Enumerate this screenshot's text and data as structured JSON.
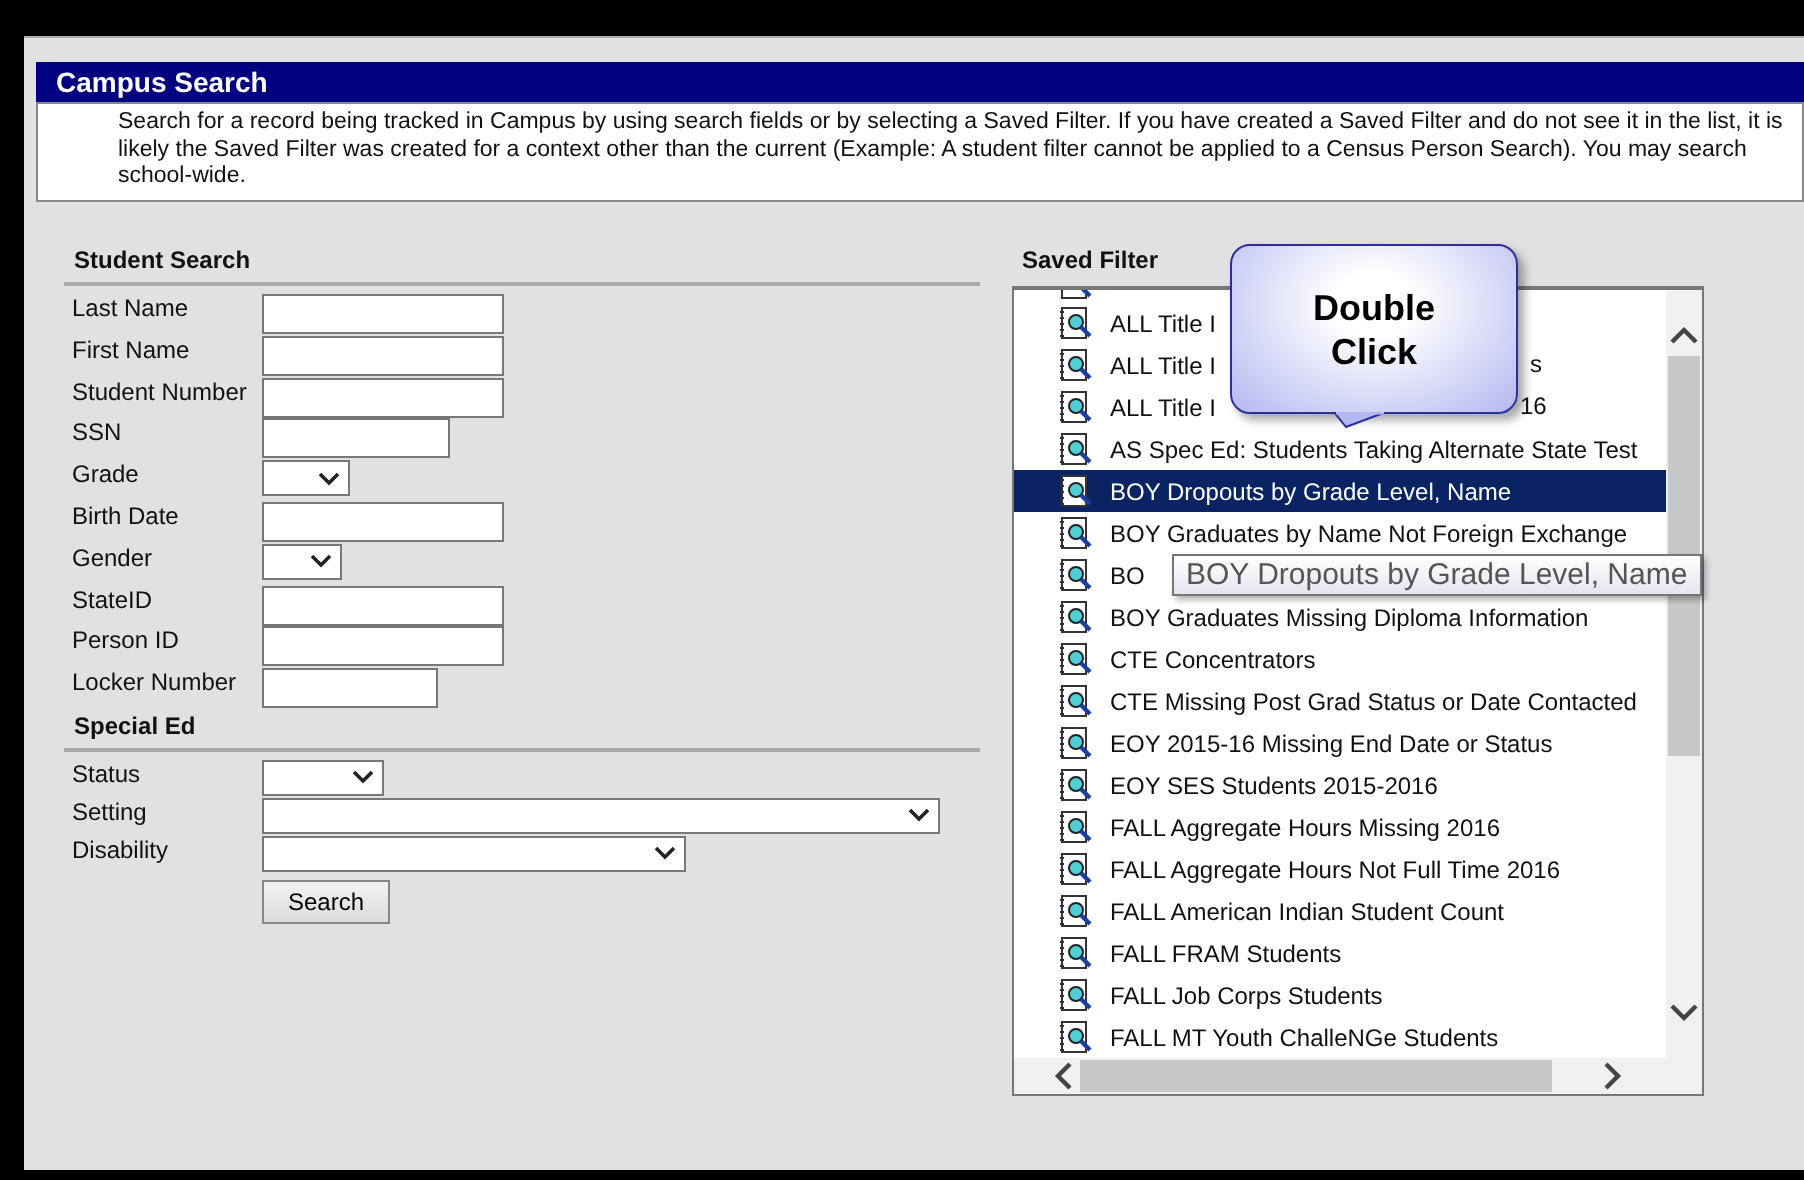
{
  "window": {
    "title": "Campus Search"
  },
  "description": "Search for a record being tracked in Campus by using search fields or by selecting a Saved Filter. If you have created a Saved Filter and do not see it in the list, it is likely the Saved Filter was created for a context other than the current (Example: A student filter cannot be applied to a Census Person Search). You may search school-wide.",
  "student_search": {
    "heading": "Student Search",
    "fields": [
      {
        "label": "Last Name",
        "kind": "text"
      },
      {
        "label": "First Name",
        "kind": "text"
      },
      {
        "label": "Student Number",
        "kind": "text"
      },
      {
        "label": "SSN",
        "kind": "text"
      },
      {
        "label": "Grade",
        "kind": "select"
      },
      {
        "label": "Birth Date",
        "kind": "text"
      },
      {
        "label": "Gender",
        "kind": "select"
      },
      {
        "label": "StateID",
        "kind": "text"
      },
      {
        "label": "Person ID",
        "kind": "text"
      },
      {
        "label": "Locker Number",
        "kind": "text"
      }
    ]
  },
  "special_ed": {
    "heading": "Special Ed",
    "fields": [
      {
        "label": "Status",
        "kind": "select"
      },
      {
        "label": "Setting",
        "kind": "select"
      },
      {
        "label": "Disability",
        "kind": "select"
      }
    ]
  },
  "search_button": "Search",
  "saved_filter": {
    "heading": "Saved Filter",
    "items": [
      {
        "label": "ALL Title I",
        "selected": false
      },
      {
        "label": "ALL Title I",
        "tail": "s",
        "selected": false
      },
      {
        "label": "ALL Title I",
        "tail": "16",
        "selected": false
      },
      {
        "label": "AS Spec Ed: Students Taking Alternate State Test",
        "selected": false
      },
      {
        "label": "BOY Dropouts by Grade Level, Name",
        "selected": true
      },
      {
        "label": "BOY Graduates by Name Not Foreign Exchange",
        "selected": false
      },
      {
        "label": "BO",
        "selected": false
      },
      {
        "label": "BOY Graduates Missing Diploma Information",
        "selected": false
      },
      {
        "label": "CTE Concentrators",
        "selected": false
      },
      {
        "label": "CTE Missing Post Grad Status or Date Contacted",
        "selected": false
      },
      {
        "label": "EOY 2015-16 Missing End Date or Status",
        "selected": false
      },
      {
        "label": "EOY SES Students 2015-2016",
        "selected": false
      },
      {
        "label": "FALL Aggregate Hours Missing 2016",
        "selected": false
      },
      {
        "label": "FALL Aggregate Hours Not Full Time 2016",
        "selected": false
      },
      {
        "label": "FALL American Indian Student Count",
        "selected": false
      },
      {
        "label": "FALL FRAM Students",
        "selected": false
      },
      {
        "label": "FALL Job Corps Students",
        "selected": false
      },
      {
        "label": "FALL MT Youth ChalleNGe Students",
        "selected": false
      }
    ]
  },
  "callout": "Double Click",
  "tooltip": "BOY Dropouts by Grade Level, Name"
}
